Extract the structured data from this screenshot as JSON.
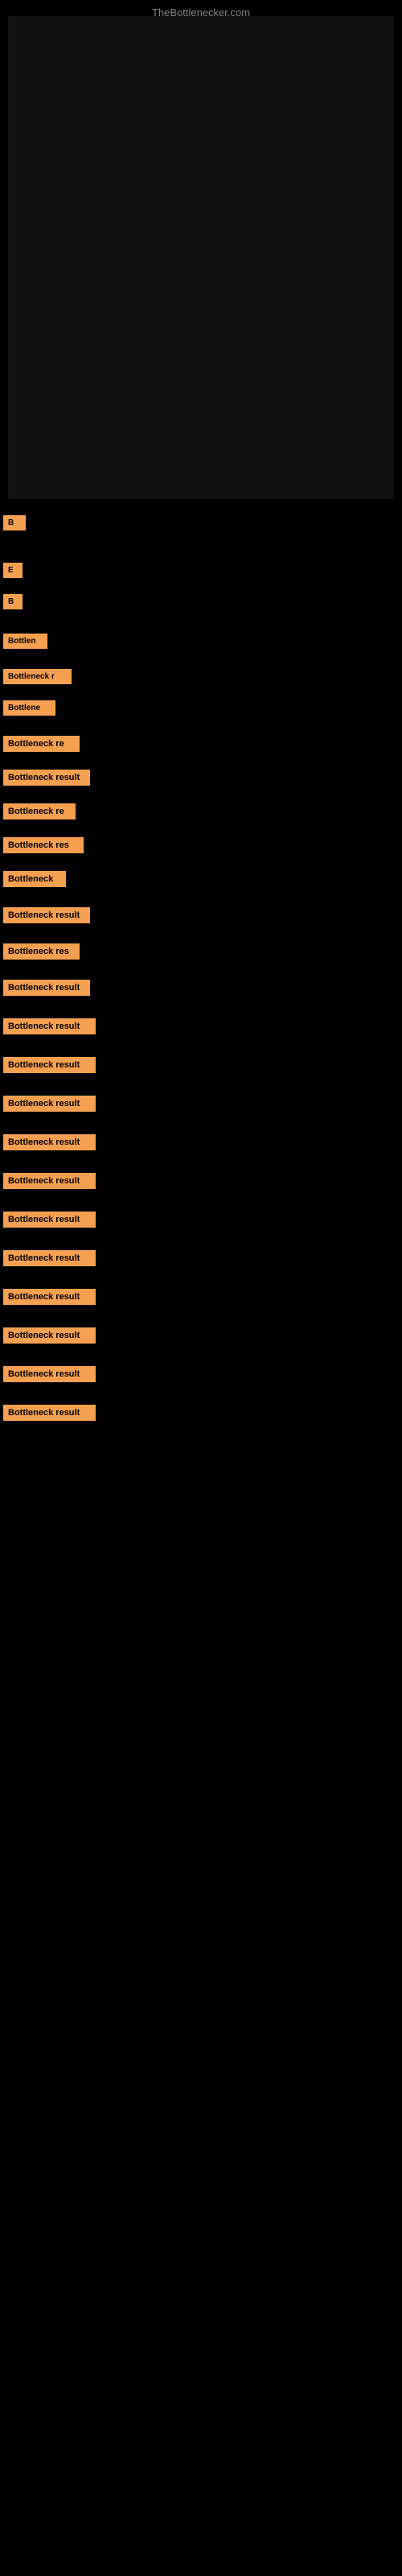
{
  "site": {
    "title": "TheBottlenecker.com"
  },
  "results": [
    {
      "label": "B"
    },
    {
      "label": "E"
    },
    {
      "label": "B"
    },
    {
      "label": "Bottlen"
    },
    {
      "label": "Bottleneck r"
    },
    {
      "label": "Bottlene"
    },
    {
      "label": "Bottleneck re"
    },
    {
      "label": "Bottleneck result"
    },
    {
      "label": "Bottleneck re"
    },
    {
      "label": "Bottleneck res"
    },
    {
      "label": "Bottleneck"
    },
    {
      "label": "Bottleneck result"
    },
    {
      "label": "Bottleneck res"
    },
    {
      "label": "Bottleneck result"
    },
    {
      "label": "Bottleneck result"
    },
    {
      "label": "Bottleneck result"
    },
    {
      "label": "Bottleneck result"
    },
    {
      "label": "Bottleneck result"
    },
    {
      "label": "Bottleneck result"
    },
    {
      "label": "Bottleneck result"
    },
    {
      "label": "Bottleneck result"
    },
    {
      "label": "Bottleneck result"
    },
    {
      "label": "Bottleneck result"
    },
    {
      "label": "Bottleneck result"
    },
    {
      "label": "Bottleneck result"
    }
  ]
}
